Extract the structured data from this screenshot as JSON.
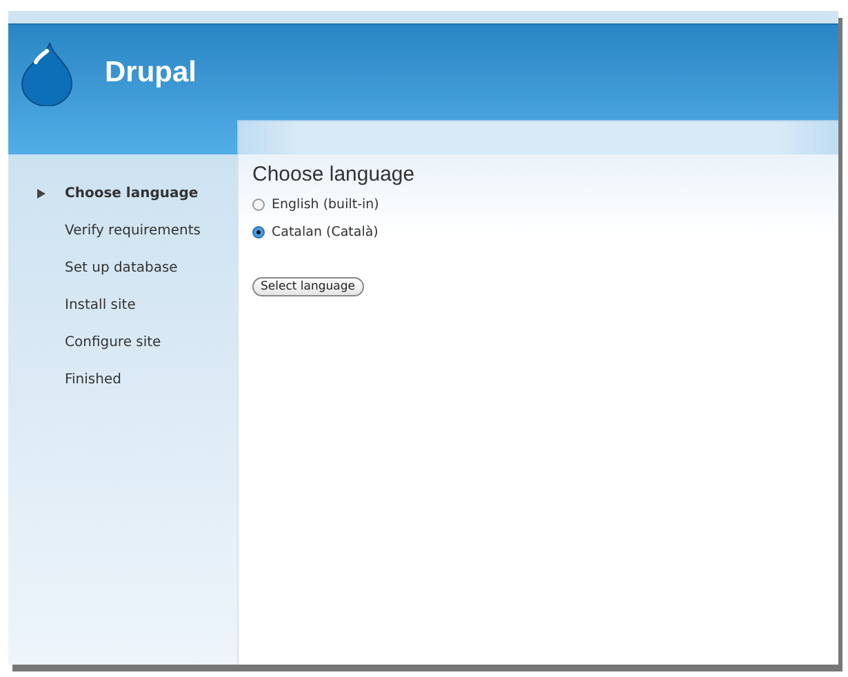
{
  "site": {
    "name": "Drupal"
  },
  "steps": [
    {
      "label": "Choose language",
      "selected": true
    },
    {
      "label": "Verify requirements",
      "selected": false
    },
    {
      "label": "Set up database",
      "selected": false
    },
    {
      "label": "Install site",
      "selected": false
    },
    {
      "label": "Configure site",
      "selected": false
    },
    {
      "label": "Finished",
      "selected": false
    }
  ],
  "content": {
    "title": "Choose language",
    "options": [
      {
        "label": "English (built-in)",
        "selected": false
      },
      {
        "label": "Catalan (Català)",
        "selected": true
      }
    ],
    "button": "Select language"
  }
}
